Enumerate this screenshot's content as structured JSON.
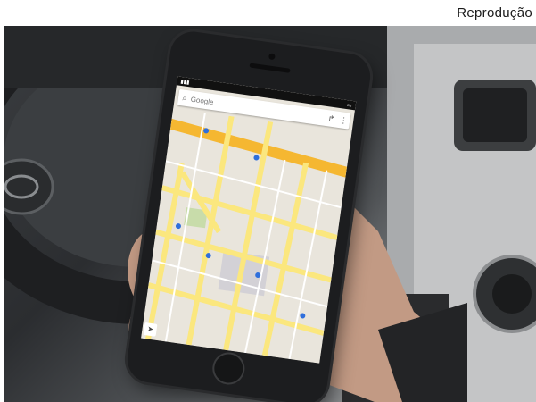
{
  "credit": "Reprodução",
  "phone_map": {
    "search_placeholder": "Google",
    "icons": [
      "search-icon",
      "directions-icon",
      "menu-icon",
      "location-icon"
    ]
  },
  "colors": {
    "map_background": "#e9e5dc",
    "highway": "#f5b731",
    "road": "#fbe77e",
    "park": "#c8dcaa",
    "marker": "#2f6fdc"
  }
}
